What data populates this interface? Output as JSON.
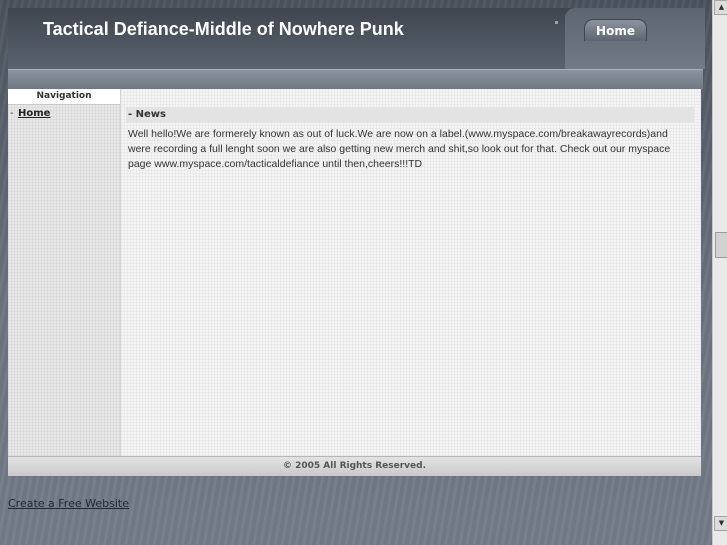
{
  "header": {
    "title": "Tactical Defiance-Middle of Nowhere Punk",
    "home_tab": "Home"
  },
  "sidebar": {
    "heading": "Navigation",
    "items": [
      {
        "bullet": "-",
        "label": "Home"
      }
    ]
  },
  "main": {
    "news_heading": "- News",
    "news_body": "Well hello!We are formerely known as out of luck.We are now on a label.(www.myspace.com/breakawayrecords)and were recording a full lenght soon we are also getting new merch and shit,so look out for that. Check out our myspace page www.myspace.com/tacticaldefiance until then,cheers!!!TD"
  },
  "footer": {
    "copyright": "© 2005 All Rights Reserved."
  },
  "bottom_link": "Create a Free Website",
  "scrollbar": {
    "up_icon": "scroll-up-arrow-icon",
    "down_icon": "scroll-down-arrow-icon"
  },
  "colors": {
    "background": "#6f7884",
    "header": "#4a525c",
    "content_bg": "#f4f4f4",
    "sidebar_bg": "#e7e7e7"
  }
}
